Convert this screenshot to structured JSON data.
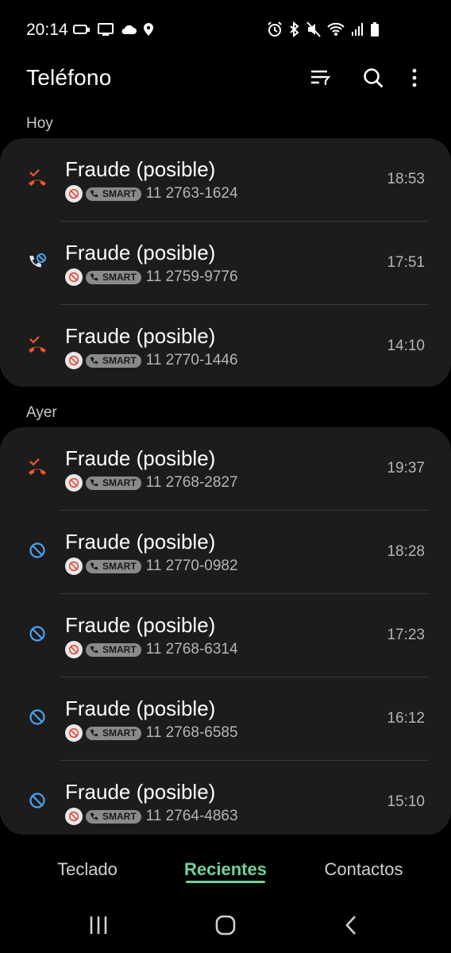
{
  "status": {
    "time": "20:14",
    "left_icons": [
      "notification-icon",
      "screen-cast-icon",
      "cloud-icon",
      "location-icon"
    ],
    "right_icons": [
      "alarm-icon",
      "bluetooth-icon",
      "mute-icon",
      "wifi-icon",
      "signal-icon",
      "battery-icon"
    ]
  },
  "header": {
    "title": "Teléfono",
    "actions": [
      "filter-icon",
      "search-icon",
      "more-icon"
    ]
  },
  "colors": {
    "accent": "#6fd39a",
    "missed": "#f0562f",
    "blocked": "#4aa3f0",
    "outgoing_blocked": "#a8c7f0"
  },
  "sections": [
    {
      "label": "Hoy",
      "calls": [
        {
          "name": "Fraude (posible)",
          "tag": "SMART",
          "number": "11 2763-1624",
          "time": "18:53",
          "type": "missed-icon"
        },
        {
          "name": "Fraude (posible)",
          "tag": "SMART",
          "number": "11 2759-9776",
          "time": "17:51",
          "type": "blocked-call-icon"
        },
        {
          "name": "Fraude (posible)",
          "tag": "SMART",
          "number": "11 2770-1446",
          "time": "14:10",
          "type": "missed-icon"
        }
      ]
    },
    {
      "label": "Ayer",
      "calls": [
        {
          "name": "Fraude (posible)",
          "tag": "SMART",
          "number": "11 2768-2827",
          "time": "19:37",
          "type": "missed-icon"
        },
        {
          "name": "Fraude (posible)",
          "tag": "SMART",
          "number": "11 2770-0982",
          "time": "18:28",
          "type": "blocked-icon"
        },
        {
          "name": "Fraude (posible)",
          "tag": "SMART",
          "number": "11 2768-6314",
          "time": "17:23",
          "type": "blocked-icon"
        },
        {
          "name": "Fraude (posible)",
          "tag": "SMART",
          "number": "11 2768-6585",
          "time": "16:12",
          "type": "blocked-icon"
        },
        {
          "name": "Fraude (posible)",
          "tag": "SMART",
          "number": "11 2764-4863",
          "time": "15:10",
          "type": "blocked-icon"
        }
      ]
    }
  ],
  "tabs": [
    {
      "label": "Teclado",
      "active": false
    },
    {
      "label": "Recientes",
      "active": true
    },
    {
      "label": "Contactos",
      "active": false
    }
  ],
  "system_nav": [
    "recent-apps-icon",
    "home-icon",
    "back-icon"
  ]
}
